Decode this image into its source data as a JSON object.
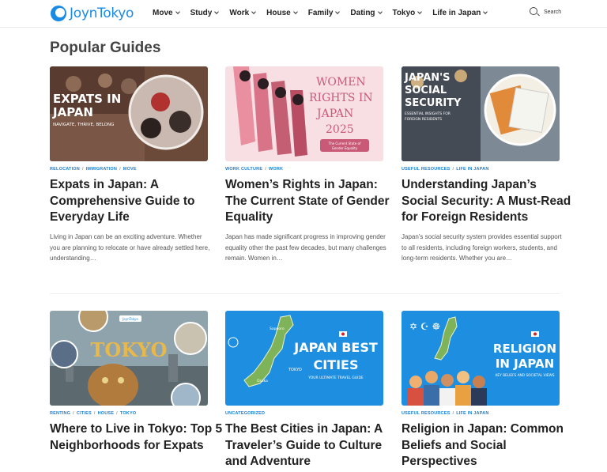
{
  "header": {
    "logo_text": "JoynTokyo",
    "nav": [
      {
        "label": "Move"
      },
      {
        "label": "Study"
      },
      {
        "label": "Work"
      },
      {
        "label": "House"
      },
      {
        "label": "Family"
      },
      {
        "label": "Dating"
      },
      {
        "label": "Tokyo"
      },
      {
        "label": "Life in Japan"
      }
    ],
    "search_label": "Search"
  },
  "section_title": "Popular Guides",
  "cards": [
    {
      "categories": [
        "Relocation",
        "Immigration",
        "Move"
      ],
      "title": "Expats in Japan: A Comprehensive Guide to Everyday Life",
      "excerpt": "Living in Japan can be an exciting adventure. Whether you are planning to relocate or have already settled here, understanding…",
      "thumb": {
        "heading": "EXPATS IN JAPAN",
        "sub": "NAVIGATE, THRIVE, BELONG"
      }
    },
    {
      "categories": [
        "Work Culture",
        "Work"
      ],
      "title": "Women’s Rights in Japan: The Current State of Gender Equality",
      "excerpt": "Japan has made significant progress in improving gender equality other the past few decades, but many challenges remain. Women in…",
      "thumb": {
        "heading": "WOMEN RIGHTS IN JAPAN 2025",
        "sub": "The Current State of Gender Equality"
      }
    },
    {
      "categories": [
        "Useful Resources",
        "Life in Japan"
      ],
      "title": "Understanding Japan’s Social Security: A Must-Read for Foreign Residents",
      "excerpt": "Japan’s social security system provides essential support to all residents, including foreign workers, students, and long-term residents. Whether you are…",
      "thumb": {
        "heading": "JAPAN'S SOCIAL SECURITY",
        "sub": "ESSENTIAL INSIGHTS FOR FOREIGN RESIDENTS"
      }
    },
    {
      "categories": [
        "Renting",
        "Cities",
        "House",
        "Tokyo"
      ],
      "title": "Where to Live in Tokyo: Top 5 Neighborhoods for Expats",
      "excerpt": "",
      "thumb": {
        "heading": "TOKYO",
        "sub": "JoynTokyo"
      }
    },
    {
      "categories": [
        "Uncategorized"
      ],
      "title": "The Best Cities in Japan: A Traveler’s Guide to Culture and Adventure",
      "excerpt": "",
      "thumb": {
        "heading": "JAPAN BEST CITIES",
        "sub": "YOUR ULTIMATE TRAVEL GUIDE"
      }
    },
    {
      "categories": [
        "Useful Resources",
        "Life in Japan"
      ],
      "title": "Religion in Japan: Common Beliefs and Social Perspectives",
      "excerpt": "",
      "thumb": {
        "heading": "RELIGION IN JAPAN",
        "sub": "KEY BELIEFS AND SOCIETAL VIEWS"
      }
    }
  ],
  "colors": {
    "accent": "#1a7fd4",
    "brand": "#1a8be5"
  }
}
